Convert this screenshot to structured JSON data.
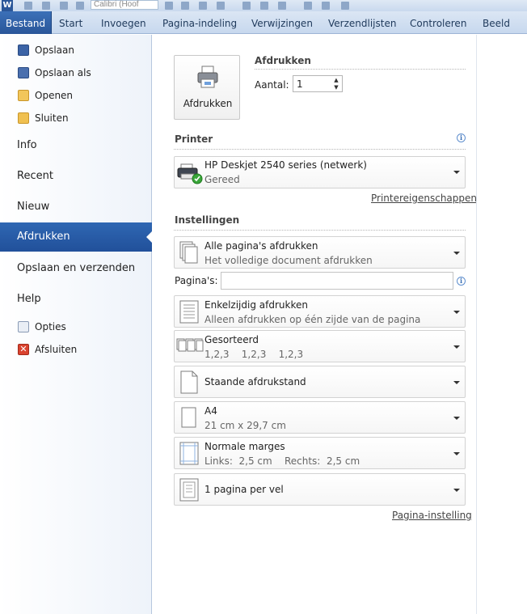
{
  "quick_access": {
    "logo_letter": "W",
    "font_box": "Calibri (Hoof"
  },
  "ribbon_tabs": [
    {
      "label": "Bestand",
      "active": true
    },
    {
      "label": "Start"
    },
    {
      "label": "Invoegen"
    },
    {
      "label": "Pagina-indeling"
    },
    {
      "label": "Verwijzingen"
    },
    {
      "label": "Verzendlijsten"
    },
    {
      "label": "Controleren"
    },
    {
      "label": "Beeld"
    }
  ],
  "sidebar": {
    "small_items": [
      {
        "label": "Opslaan",
        "icon": "save-icon"
      },
      {
        "label": "Opslaan als",
        "icon": "save-as-icon"
      },
      {
        "label": "Openen",
        "icon": "open-folder-icon"
      },
      {
        "label": "Sluiten",
        "icon": "close-folder-icon"
      }
    ],
    "info": "Info",
    "recent": "Recent",
    "new": "Nieuw",
    "print": "Afdrukken",
    "save_send": "Opslaan en verzenden",
    "help": "Help",
    "options": "Opties",
    "exit": "Afsluiten"
  },
  "print": {
    "button_label": "Afdrukken",
    "title": "Afdrukken",
    "copies_label": "Aantal:",
    "copies_value": "1"
  },
  "printer": {
    "section": "Printer",
    "name": "HP Deskjet 2540 series (netwerk)",
    "status": "Gereed",
    "properties_link": "Printereigenschappen"
  },
  "settings": {
    "section": "Instellingen",
    "pages_label": "Pagina's:",
    "pages_value": "",
    "page_setup_link": "Pagina-instelling",
    "options": [
      {
        "title": "Alle pagina's afdrukken",
        "subtitle": "Het volledige document afdrukken"
      },
      {
        "title": "Enkelzijdig afdrukken",
        "subtitle": "Alleen afdrukken op één zijde van de pagina"
      },
      {
        "title": "Gesorteerd",
        "subtitle": "1,2,3    1,2,3    1,2,3"
      },
      {
        "title": "Staande afdrukstand",
        "subtitle": ""
      },
      {
        "title": "A4",
        "subtitle": "21 cm x 29,7 cm"
      },
      {
        "title": "Normale marges",
        "subtitle": "Links:  2,5 cm    Rechts:  2,5 cm"
      },
      {
        "title": "1 pagina per vel",
        "subtitle": ""
      }
    ]
  },
  "colors": {
    "accent": "#2a5699",
    "active_sidebar": "#2f67b3"
  }
}
